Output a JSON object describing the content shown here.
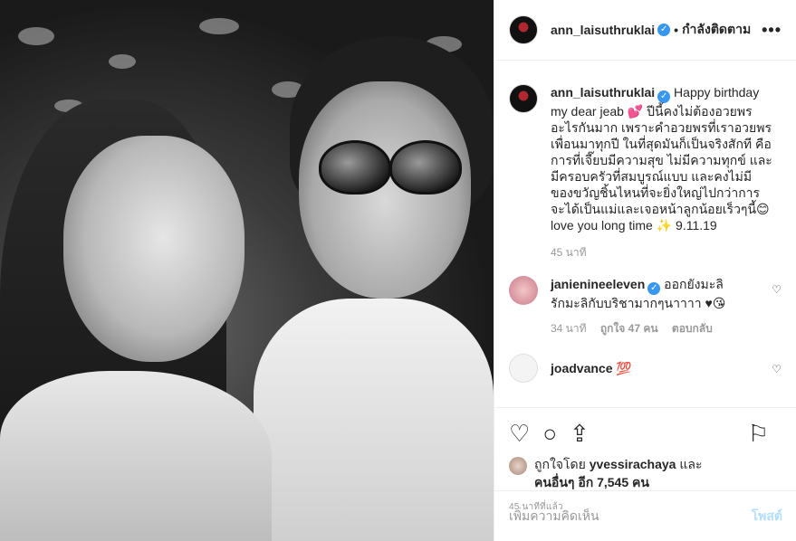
{
  "header": {
    "username": "ann_laisuthruklai",
    "verified_mark": "✓",
    "separator": "•",
    "follow_label": "กำลังติดตาม",
    "more_icon": "•••"
  },
  "caption": {
    "username": "ann_laisuthruklai",
    "text": "Happy birthday my dear jeab 💕 ปีนี้คงไม่ต้องอวยพรอะไรกันมาก เพราะคำอวยพรที่เราอวยพรเพื่อนมาทุกปี ในที่สุดมันก็เป็นจริงสักที คือการที่เจี๊ยบมีความสุข ไม่มีความทุกข์ และมีครอบครัวที่สมบูรณ์แบบ และคงไม่มีของขวัญชิ้นไหนที่จะยิ่งใหญ่ไปกว่าการจะได้เป็นแม่และเจอหน้าลูกน้อยเร็วๆนี้😊 love you long time ✨ 9.11.19",
    "time": "45 นาที"
  },
  "comments": [
    {
      "username": "janienineeleven",
      "text": "ออกยังมะลิ รักมะลิกับบริชามากๆนาาาา ♥😘",
      "time": "34 นาที",
      "likes": "ถูกใจ 47 คน",
      "reply": "ตอบกลับ"
    },
    {
      "username": "joadvance",
      "text": "💯",
      "time": "",
      "likes": "",
      "reply": ""
    }
  ],
  "actions": {
    "like_icon": "♡",
    "comment_icon": "○",
    "share_icon": "⇪",
    "save_icon": "⚐"
  },
  "likes": {
    "prefix": "ถูกใจโดย",
    "user": "yvessirachaya",
    "mid": "และ",
    "others": "คนอื่นๆ อีก 7,545 คน"
  },
  "posted": "45 นาทีที่แล้ว",
  "add_comment": {
    "placeholder": "เพิ่มความคิดเห็น",
    "post_label": "โพสต์"
  },
  "colors": {
    "accent": "#3897f0",
    "post_disabled": "#b2dffc",
    "muted": "#999999"
  }
}
